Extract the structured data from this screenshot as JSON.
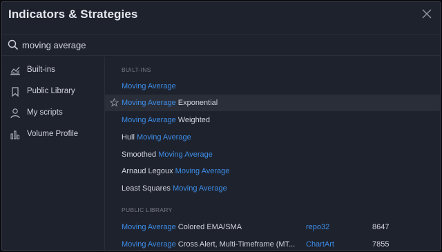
{
  "dialog": {
    "title": "Indicators & Strategies"
  },
  "search": {
    "value": "moving average"
  },
  "sidebar": {
    "items": [
      {
        "label": "Built-ins",
        "icon": "chart-icon"
      },
      {
        "label": "Public Library",
        "icon": "bookmark-icon"
      },
      {
        "label": "My scripts",
        "icon": "user-icon"
      },
      {
        "label": "Volume Profile",
        "icon": "volume-profile-icon"
      }
    ]
  },
  "builtins": {
    "header": "BUILT-INS",
    "items": [
      {
        "pre": "",
        "match": "Moving Average",
        "post": ""
      },
      {
        "pre": "",
        "match": "Moving Average",
        "post": " Exponential"
      },
      {
        "pre": "",
        "match": "Moving Average",
        "post": " Weighted"
      },
      {
        "pre": "Hull ",
        "match": "Moving Average",
        "post": ""
      },
      {
        "pre": "Smoothed ",
        "match": "Moving Average",
        "post": ""
      },
      {
        "pre": "Arnaud Legoux ",
        "match": "Moving Average",
        "post": ""
      },
      {
        "pre": "Least Squares ",
        "match": "Moving Average",
        "post": ""
      }
    ]
  },
  "library": {
    "header": "PUBLIC LIBRARY",
    "items": [
      {
        "match": "Moving Average",
        "post": " Colored EMA/SMA",
        "author": "repo32",
        "count": "8647"
      },
      {
        "match": "Moving Average",
        "post": " Cross Alert, Multi-Timeframe (MT...",
        "author": "ChartArt",
        "count": "7855"
      }
    ]
  },
  "colors": {
    "accent": "#3d8ee8",
    "background": "#1e222d",
    "highlight": "#2a2e39"
  }
}
